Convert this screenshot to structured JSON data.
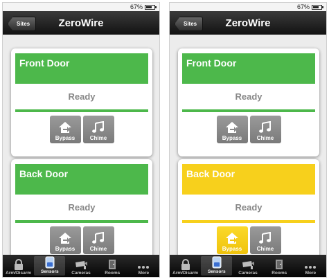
{
  "statusbar": {
    "battery": "67%"
  },
  "navbar": {
    "back_label": "Sites",
    "title": "ZeroWire"
  },
  "colors": {
    "green": "#4db84b",
    "yellow": "#f7d01c",
    "button_gray": "#8a8a8a"
  },
  "screens": [
    {
      "sensors": [
        {
          "name": "Front Door",
          "status": "Ready",
          "state": "ready",
          "buttons": {
            "bypass": "Bypass",
            "chime": "Chime"
          },
          "bypass_active": false
        },
        {
          "name": "Back Door",
          "status": "Ready",
          "state": "ready",
          "buttons": {
            "bypass": "Bypass",
            "chime": "Chime"
          },
          "bypass_active": false
        }
      ]
    },
    {
      "sensors": [
        {
          "name": "Front Door",
          "status": "Ready",
          "state": "ready",
          "buttons": {
            "bypass": "Bypass",
            "chime": "Chime"
          },
          "bypass_active": false
        },
        {
          "name": "Back Door",
          "status": "Ready",
          "state": "bypassed",
          "buttons": {
            "bypass": "Bypass",
            "chime": "Chime"
          },
          "bypass_active": true
        }
      ]
    }
  ],
  "tabs": [
    {
      "label": "Arm/Disarm",
      "icon": "lock-icon",
      "active": false
    },
    {
      "label": "Sensors",
      "icon": "sensor-icon",
      "active": true
    },
    {
      "label": "Cameras",
      "icon": "camera-icon",
      "active": false
    },
    {
      "label": "Rooms",
      "icon": "rooms-icon",
      "active": false
    },
    {
      "label": "More",
      "icon": "more-icon",
      "active": false
    }
  ]
}
